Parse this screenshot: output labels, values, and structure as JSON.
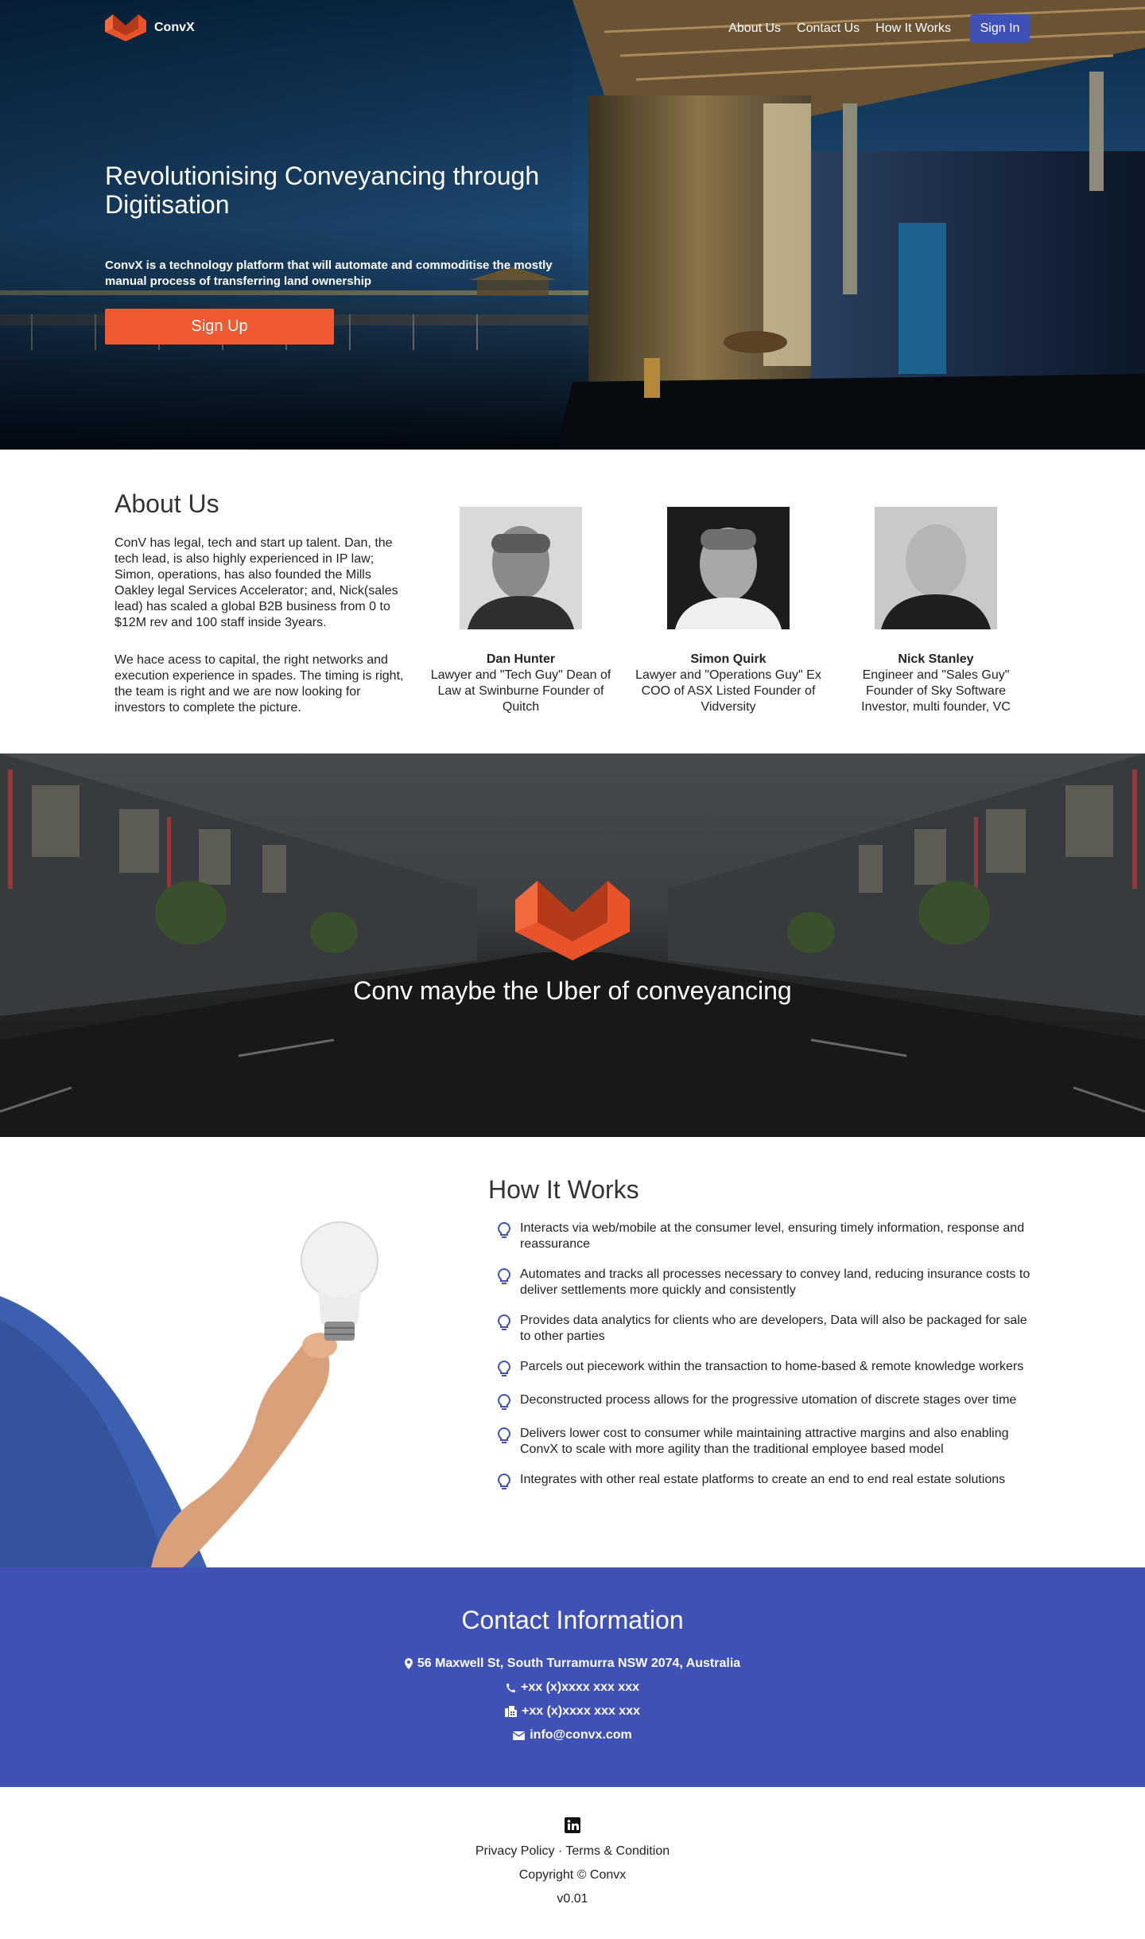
{
  "colors": {
    "primary": "#3f51b5",
    "accent": "#f05a32",
    "text": "#222222"
  },
  "header": {
    "brand": "ConvX",
    "logo_icon": "convx-logo-icon",
    "nav": [
      {
        "label": "About Us"
      },
      {
        "label": "Contact Us"
      },
      {
        "label": "How It Works"
      }
    ],
    "signin_label": "Sign In"
  },
  "hero": {
    "title": "Revolutionising Conveyancing through Digitisation",
    "subtitle": "ConvX is a technology platform that will automate and commoditise the mostly manual process of transferring land ownership",
    "signup_label": "Sign Up"
  },
  "about": {
    "title": "About Us",
    "paragraphs": [
      "ConV has legal, tech and start up talent. Dan, the tech lead, is also highly experienced in IP law; Simon, operations, has also founded the Mills Oakley legal Services Accelerator; and, Nick(sales lead) has scaled a global B2B business from 0 to $12M rev and 100 staff inside 3years.",
      "We hace acess to capital, the right networks and execution experience in spades. The timing is right, the team is right and we are now looking for investors to complete the picture."
    ],
    "team": [
      {
        "name": "Dan Hunter",
        "desc": "Lawyer and \"Tech Guy\" Dean of Law at Swinburne Founder of Quitch"
      },
      {
        "name": "Simon Quirk",
        "desc": "Lawyer and \"Operations Guy\" Ex COO of ASX Listed Founder of Vidversity"
      },
      {
        "name": "Nick Stanley",
        "desc": "Engineer and \"Sales Guy\" Founder of Sky Software Investor, multi founder, VC"
      }
    ]
  },
  "tagline": {
    "text": "Conv maybe the Uber of conveyancing"
  },
  "how": {
    "title": "How It Works",
    "bullet_icon": "lightbulb-icon",
    "items": [
      "Interacts via web/mobile at the consumer level, ensuring timely information, response and reassurance",
      "Automates and tracks all processes necessary to convey land, reducing insurance costs to deliver settlements more quickly and consistently",
      "Provides data analytics for clients who are developers, Data will also be packaged for sale to other parties",
      "Parcels out piecework within the transaction to home-based & remote knowledge workers",
      "Deconstructed process allows for the progressive utomation of discrete stages over time",
      "Delivers lower cost to consumer while maintaining attractive margins and also enabling ConvX to scale with more agility than the traditional employee based model",
      "Integrates with other real estate platforms to create an end to end real estate solutions"
    ]
  },
  "contact": {
    "title": "Contact Information",
    "address": "56 Maxwell St, South Turramurra NSW 2074, Australia",
    "phone": "+xx (x)xxxx xxx xxx",
    "fax": "+xx (x)xxxx xxx xxx",
    "email": "info@convx.com"
  },
  "footer": {
    "social_icon": "linkedin-icon",
    "privacy": "Privacy Policy",
    "separator": "·",
    "terms": "Terms & Condition",
    "copyright": "Copyright © Convx",
    "version": "v0.01"
  }
}
